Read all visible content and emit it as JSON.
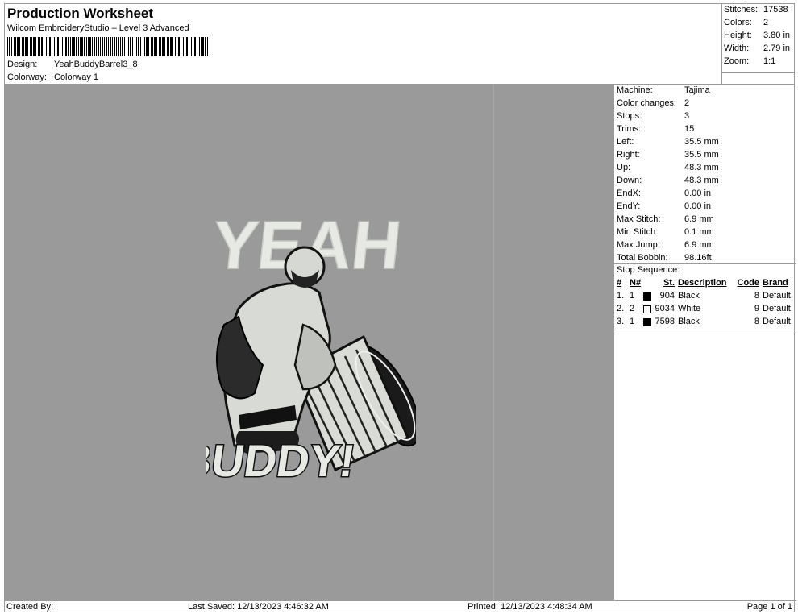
{
  "header": {
    "title": "Production Worksheet",
    "subtitle": "Wilcom EmbroideryStudio – Level 3 Advanced",
    "design_label": "Design:",
    "design_value": "YeahBuddyBarrel3_8",
    "colorway_label": "Colorway:",
    "colorway_value": "Colorway 1"
  },
  "stats": [
    {
      "label": "Stitches:",
      "value": "17538"
    },
    {
      "label": "Colors:",
      "value": "2"
    },
    {
      "label": "Height:",
      "value": "3.80 in"
    },
    {
      "label": "Width:",
      "value": "2.79 in"
    },
    {
      "label": "Zoom:",
      "value": "1:1"
    }
  ],
  "design": {
    "text_top": "YEAH",
    "text_bottom": "BUDDY!"
  },
  "info": [
    {
      "label": "Machine:",
      "value": "Tajima"
    },
    {
      "label": "Color changes:",
      "value": "2"
    },
    {
      "label": "Stops:",
      "value": "3"
    },
    {
      "label": "Trims:",
      "value": "15"
    },
    {
      "label": "Left:",
      "value": "35.5 mm"
    },
    {
      "label": "Right:",
      "value": "35.5 mm"
    },
    {
      "label": "Up:",
      "value": "48.3 mm"
    },
    {
      "label": "Down:",
      "value": "48.3 mm"
    },
    {
      "label": "EndX:",
      "value": "0.00 in"
    },
    {
      "label": "EndY:",
      "value": "0.00 in"
    },
    {
      "label": "Max Stitch:",
      "value": "6.9 mm"
    },
    {
      "label": "Min Stitch:",
      "value": "0.1 mm"
    },
    {
      "label": "Max Jump:",
      "value": "6.9 mm"
    },
    {
      "label": "Total Bobbin:",
      "value": "98.16ft"
    }
  ],
  "stop_sequence": {
    "title": "Stop Sequence:",
    "headers": {
      "num": "#",
      "n": "N#",
      "st": "St.",
      "description": "Description",
      "code": "Code",
      "brand": "Brand"
    },
    "rows": [
      {
        "num": "1.",
        "n": "1",
        "color": "#000000",
        "st": "904",
        "description": "Black",
        "code": "8",
        "brand": "Default"
      },
      {
        "num": "2.",
        "n": "2",
        "color": "#ffffff",
        "st": "9034",
        "description": "White",
        "code": "9",
        "brand": "Default"
      },
      {
        "num": "3.",
        "n": "1",
        "color": "#000000",
        "st": "7598",
        "description": "Black",
        "code": "8",
        "brand": "Default"
      }
    ]
  },
  "footer": {
    "created_by": "Created By:",
    "last_saved": "Last Saved: 12/13/2023 4:46:32 AM",
    "printed": "Printed: 12/13/2023 4:48:34 AM",
    "page": "Page 1 of 1"
  },
  "colors": {
    "design_background": "#9a9a9a",
    "thread_white": "#e9ece7",
    "thread_black": "#111111"
  }
}
